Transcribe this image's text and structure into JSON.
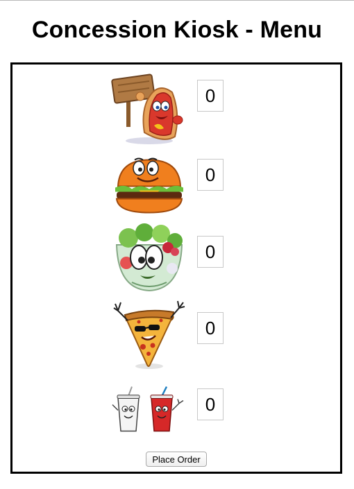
{
  "page": {
    "title": "Concession Kiosk - Menu"
  },
  "menu": {
    "items": [
      {
        "icon": "hotdog-mascot-icon",
        "quantity": "0"
      },
      {
        "icon": "burger-mascot-icon",
        "quantity": "0"
      },
      {
        "icon": "salad-bowl-mascot-icon",
        "quantity": "0"
      },
      {
        "icon": "pizza-slice-mascot-icon",
        "quantity": "0"
      },
      {
        "icon": "soda-cups-mascot-icon",
        "quantity": "0"
      }
    ]
  },
  "actions": {
    "place_order_label": "Place Order"
  },
  "colors": {
    "border": "#000000",
    "background": "#ffffff"
  }
}
